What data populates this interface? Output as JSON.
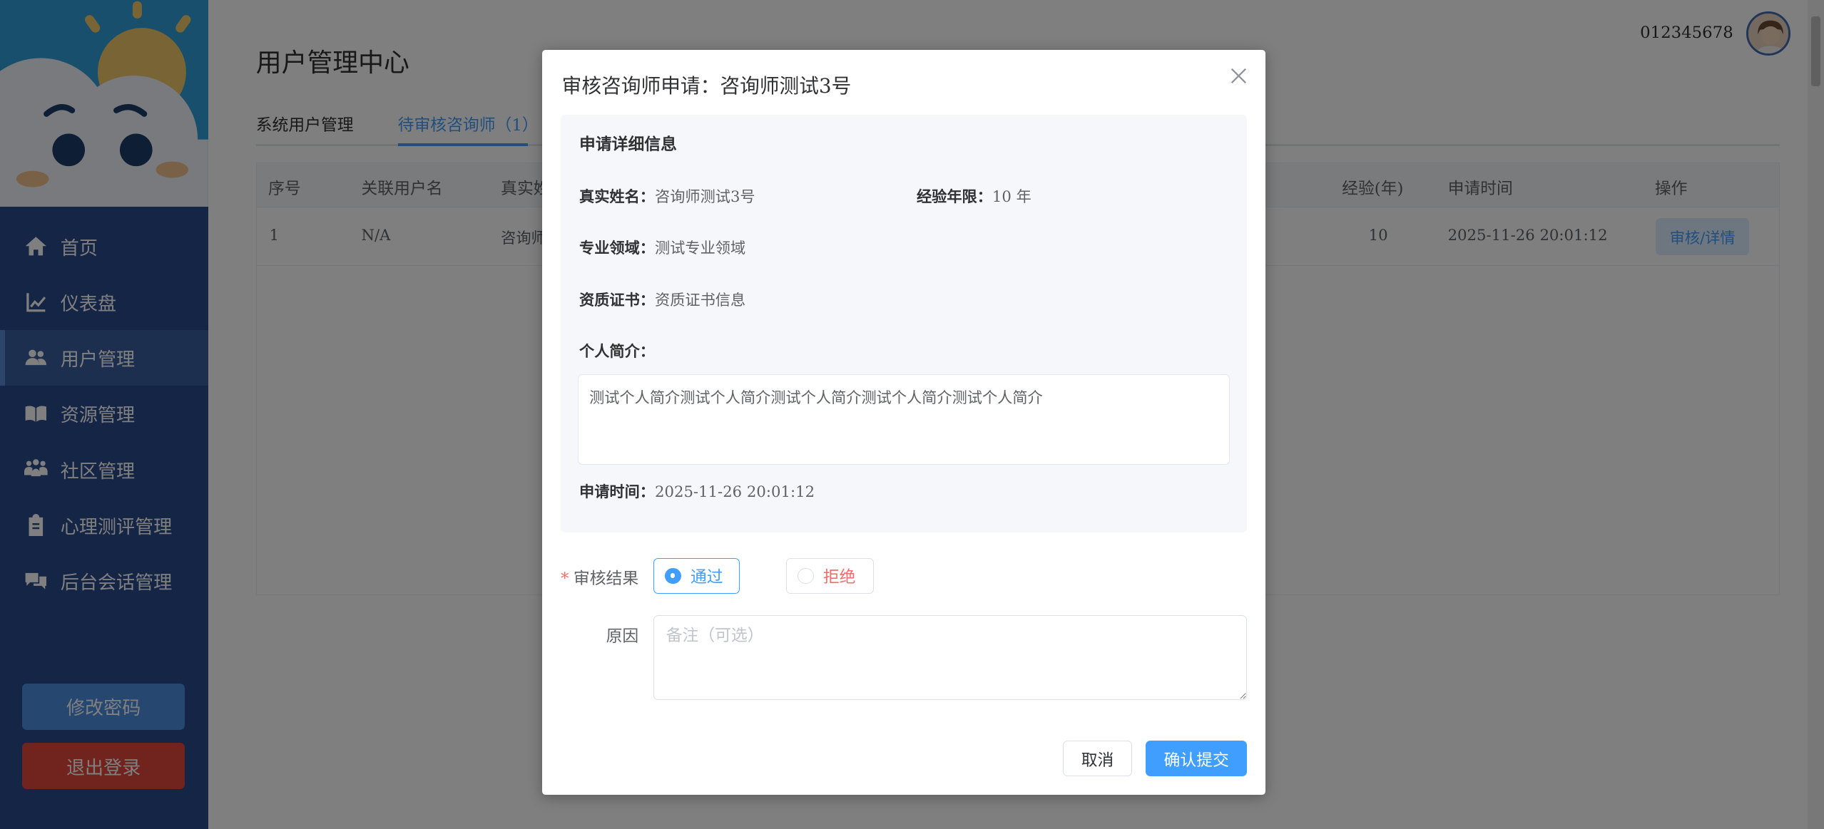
{
  "sidebar": {
    "items": [
      {
        "label": "首页",
        "icon": "home-icon"
      },
      {
        "label": "仪表盘",
        "icon": "chart-line-icon"
      },
      {
        "label": "用户管理",
        "icon": "users-icon",
        "active": true
      },
      {
        "label": "资源管理",
        "icon": "book-icon"
      },
      {
        "label": "社区管理",
        "icon": "people-group-icon"
      },
      {
        "label": "心理测评管理",
        "icon": "clipboard-icon"
      },
      {
        "label": "后台会话管理",
        "icon": "comments-icon"
      }
    ],
    "change_password": "修改密码",
    "logout": "退出登录"
  },
  "header": {
    "title": "用户管理中心",
    "user_id": "012345678"
  },
  "tabs": [
    {
      "label": "系统用户管理"
    },
    {
      "label": "待审核咨询师（1）",
      "active": true
    }
  ],
  "table": {
    "columns": [
      "序号",
      "关联用户名",
      "真实姓",
      "经验(年)",
      "申请时间",
      "操作"
    ],
    "rows": [
      {
        "index": "1",
        "username": "N/A",
        "real_name": "咨询师",
        "experience": "10",
        "apply_time": "2025-11-26 20:01:12",
        "action": "审核/详情"
      }
    ]
  },
  "dialog": {
    "title": "审核咨询师申请：咨询师测试3号",
    "section_title": "申请详细信息",
    "real_name_label": "真实姓名：",
    "real_name": "咨询师测试3号",
    "experience_label": "经验年限：",
    "experience": "10 年",
    "field_label": "专业领域：",
    "field": "测试专业领域",
    "cert_label": "资质证书：",
    "cert": "资质证书信息",
    "bio_label": "个人简介：",
    "bio": "测试个人简介测试个人简介测试个人简介测试个人简介测试个人简介",
    "apply_time_label": "申请时间：",
    "apply_time": "2025-11-26 20:01:12",
    "result_label": "审核结果",
    "option_pass": "通过",
    "option_reject": "拒绝",
    "reason_label": "原因",
    "reason_placeholder": "备注（可选）",
    "cancel": "取消",
    "confirm": "确认提交"
  },
  "colors": {
    "sidebar": "#2b4a8c",
    "primary": "#409eff",
    "danger": "#f56c6c",
    "logout": "#e0483b"
  }
}
